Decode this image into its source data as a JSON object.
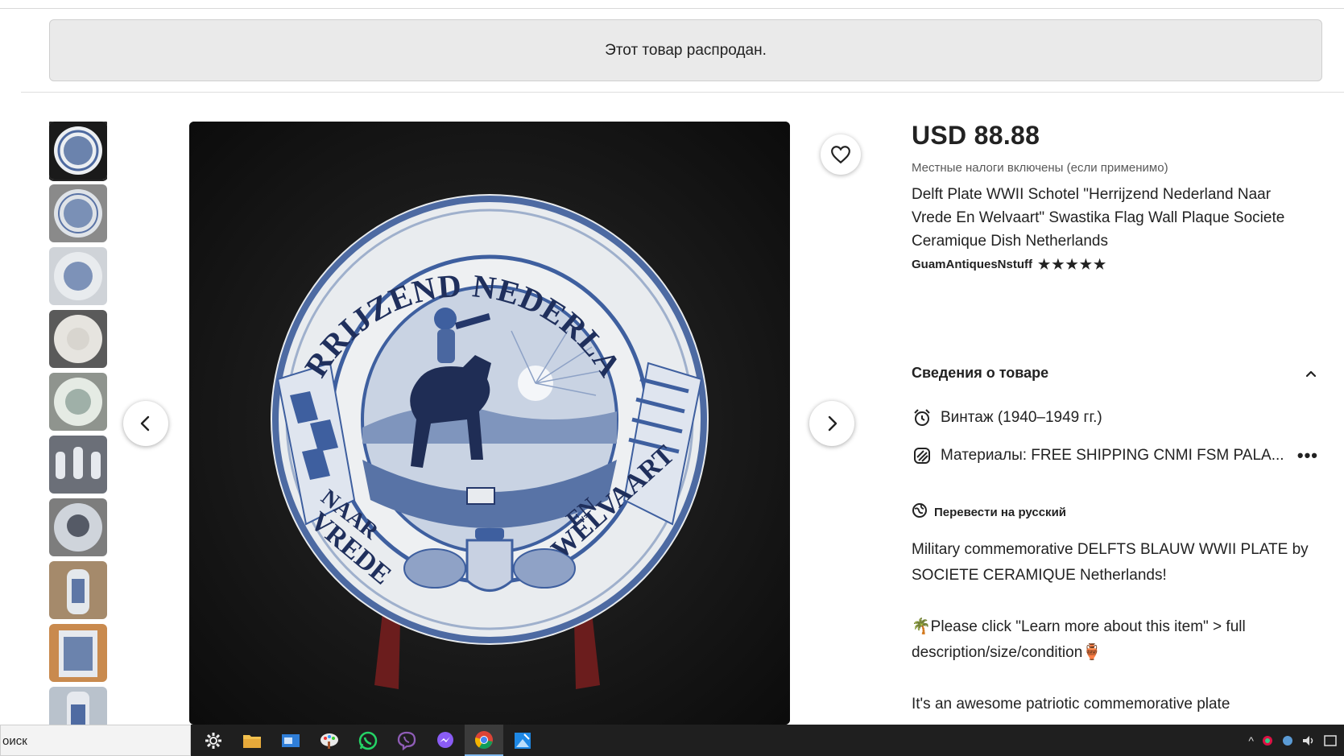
{
  "banner": {
    "text": "Этот товар распродан."
  },
  "listing": {
    "price": "USD 88.88",
    "tax_note": "Местные налоги включены (если применимо)",
    "title": "Delft Plate WWII Schotel \"Herrijzend Nederland Naar Vrede En Welvaart\" Swastika Flag Wall Plaque Societe Ceramique Dish Netherlands",
    "shop_name": "GuamAntiquesNstuff",
    "rating_stars": 5
  },
  "details": {
    "heading": "Сведения о товаре",
    "vintage": "Винтаж (1940–1949 гг.)",
    "materials": "Материалы: FREE SHIPPING CNMI FSM PALA...",
    "more": "•••"
  },
  "translate": {
    "label": "Перевести на русский"
  },
  "description": {
    "p1": "Military commemorative DELFTS BLAUW WWII PLATE by SOCIETE CERAMIQUE Netherlands!",
    "p2": "Please click \"Learn more about this item\" > full description/size/condition",
    "p2_prefix_icon": "🌴",
    "p2_suffix_icon": "🏺",
    "p3": "It's an awesome patriotic commemorative plate"
  },
  "plate": {
    "top_text": "HERRIJZEND NEDERLAND",
    "left_small": "NAAR",
    "left_big": "VREDE",
    "right_small": "EN",
    "right_big": "WELVAART"
  },
  "thumbnails": {
    "count": 10,
    "active_index": 0
  },
  "taskbar": {
    "search_text": "оиск",
    "apps": [
      "settings-icon",
      "file-explorer-icon",
      "mail-icon",
      "paint-icon",
      "whatsapp-icon",
      "viber-icon",
      "messenger-icon",
      "chrome-icon",
      "photos-icon"
    ]
  },
  "colors": {
    "delft_blue": "#3e5f9f",
    "plate_cream": "#eef0f2",
    "image_bg": "#141414"
  }
}
